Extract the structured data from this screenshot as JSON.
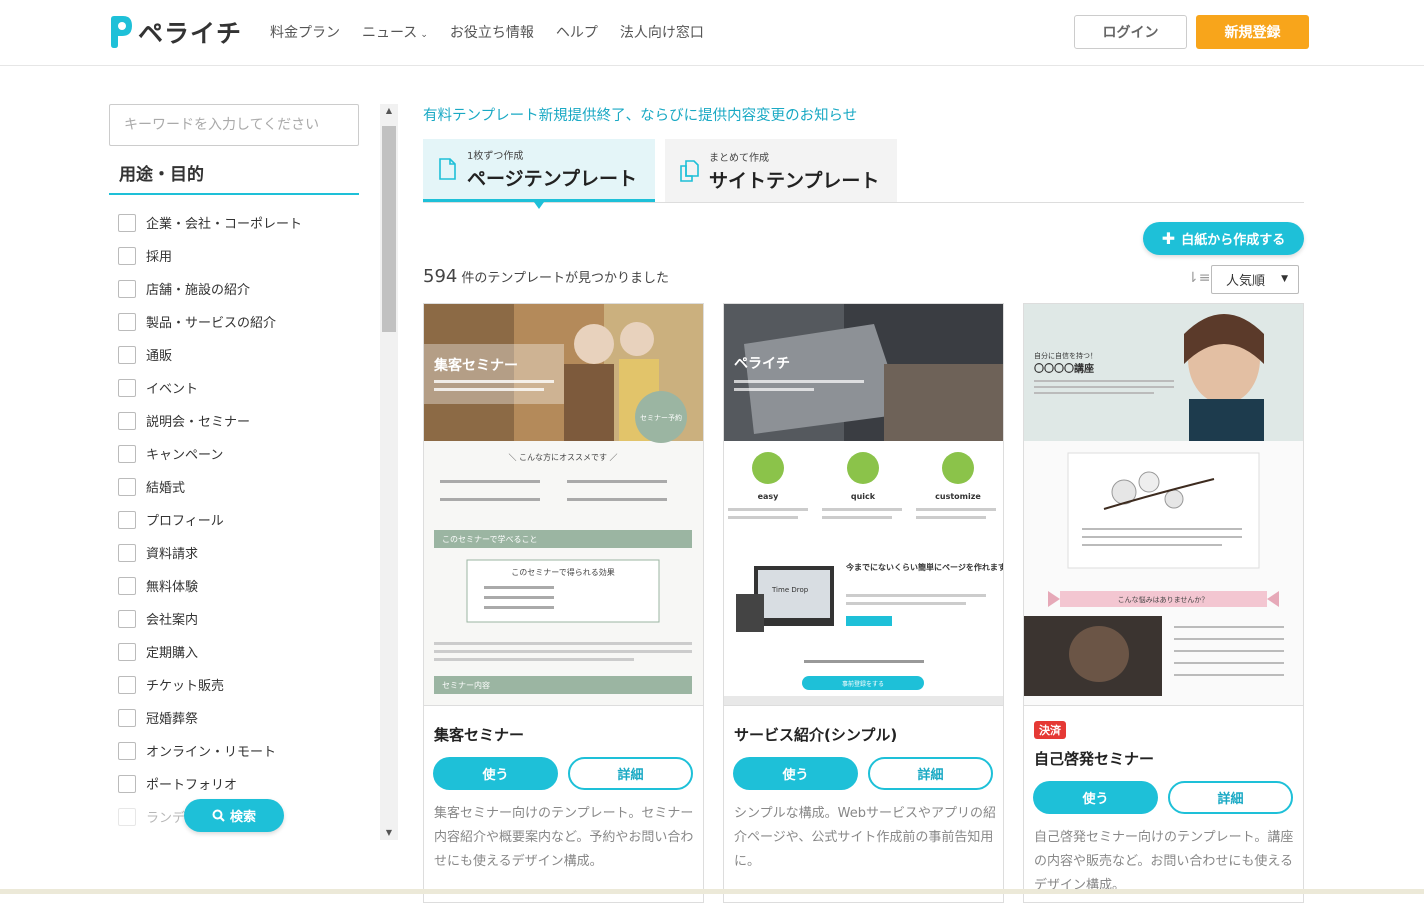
{
  "header": {
    "logo_text": "ペライチ",
    "nav": [
      {
        "label": "料金プラン",
        "dropdown": false
      },
      {
        "label": "ニュース",
        "dropdown": true
      },
      {
        "label": "お役立ち情報",
        "dropdown": false
      },
      {
        "label": "ヘルプ",
        "dropdown": false
      },
      {
        "label": "法人向け窓口",
        "dropdown": false
      }
    ],
    "login_label": "ログイン",
    "signup_label": "新規登録"
  },
  "sidebar": {
    "search_placeholder": "キーワードを入力してください",
    "section_title": "用途・目的",
    "categories": [
      "企業・会社・コーポレート",
      "採用",
      "店舗・施設の紹介",
      "製品・サービスの紹介",
      "通販",
      "イベント",
      "説明会・セミナー",
      "キャンペーン",
      "結婚式",
      "プロフィール",
      "資料請求",
      "無料体験",
      "会社案内",
      "定期購入",
      "チケット販売",
      "冠婚葬祭",
      "オンライン・リモート",
      "ポートフォリオ",
      "ランディング"
    ],
    "search_button": "検索"
  },
  "main": {
    "notice": "有料テンプレート新規提供終了、ならびに提供内容変更のお知らせ",
    "tabs": [
      {
        "sub": "1枚ずつ作成",
        "label": "ページテンプレート"
      },
      {
        "sub": "まとめて作成",
        "label": "サイトテンプレート"
      }
    ],
    "blank_button": "白紙から作成する",
    "count_number": "594",
    "count_suffix": "件のテンプレートが見つかりました",
    "sort_value": "人気順",
    "cards": [
      {
        "title": "集客セミナー",
        "badge": "",
        "use_label": "使う",
        "detail_label": "詳細",
        "description": "集客セミナー向けのテンプレート。セミナー内容紹介や概要案内など。予約やお問い合わせにも使えるデザイン構成。",
        "thumb": {
          "hero_title": "集客セミナー",
          "circle_label": "セミナー予約",
          "recommend": "＼ こんな方にオススメです ／",
          "band1": "このセミナーで学べること",
          "box_title": "このセミナーで得られる効果",
          "band2": "セミナー内容"
        }
      },
      {
        "title": "サービス紹介(シンプル)",
        "badge": "",
        "use_label": "使う",
        "detail_label": "詳細",
        "description": "シンプルな構成。Webサービスやアプリの紹介ページや、公式サイト作成前の事前告知用に。",
        "thumb": {
          "hero_title": "ペライチ",
          "features": [
            "easy",
            "quick",
            "customize"
          ],
          "headline": "今までにないくらい簡単にページを作れます",
          "device_label": "Time Drop",
          "cta": "事前登録をする"
        }
      },
      {
        "title": "自己啓発セミナー",
        "badge": "決済",
        "use_label": "使う",
        "detail_label": "詳細",
        "description": "自己啓発セミナー向けのテンプレート。講座の内容や販売など。お問い合わせにも使えるデザイン構成。",
        "thumb": {
          "hero_sub": "自分に自信を持つ！",
          "hero_title": "〇〇〇〇講座",
          "ribbon": "こんな悩みはありませんか？"
        }
      }
    ]
  },
  "colors": {
    "accent": "#1ec0d8",
    "signup": "#f8a51b",
    "badge": "#e53935",
    "seminar_green": "#9bb5a2"
  }
}
